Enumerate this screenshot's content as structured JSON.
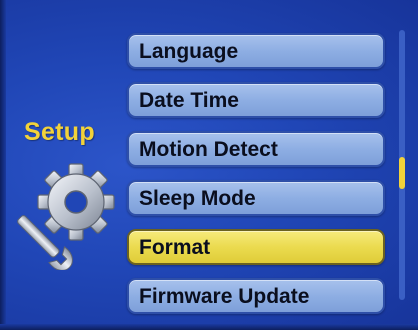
{
  "setup": {
    "title": "Setup"
  },
  "menu": {
    "items": [
      {
        "label": "Language",
        "selected": false
      },
      {
        "label": "Date Time",
        "selected": false
      },
      {
        "label": "Motion Detect",
        "selected": false
      },
      {
        "label": "Sleep Mode",
        "selected": false
      },
      {
        "label": "Format",
        "selected": true
      },
      {
        "label": "Firmware Update",
        "selected": false
      }
    ]
  },
  "scroll": {
    "thumb_start_fraction": 0.47,
    "thumb_length_fraction": 0.12
  },
  "colors": {
    "background": "#2046b6",
    "item_fill": "#8eaee3",
    "selected_fill": "#ebdb4f",
    "title_text": "#f2d23a",
    "item_text": "#0a0e1e"
  },
  "icons": {
    "setup": "gear-wrench-icon"
  }
}
